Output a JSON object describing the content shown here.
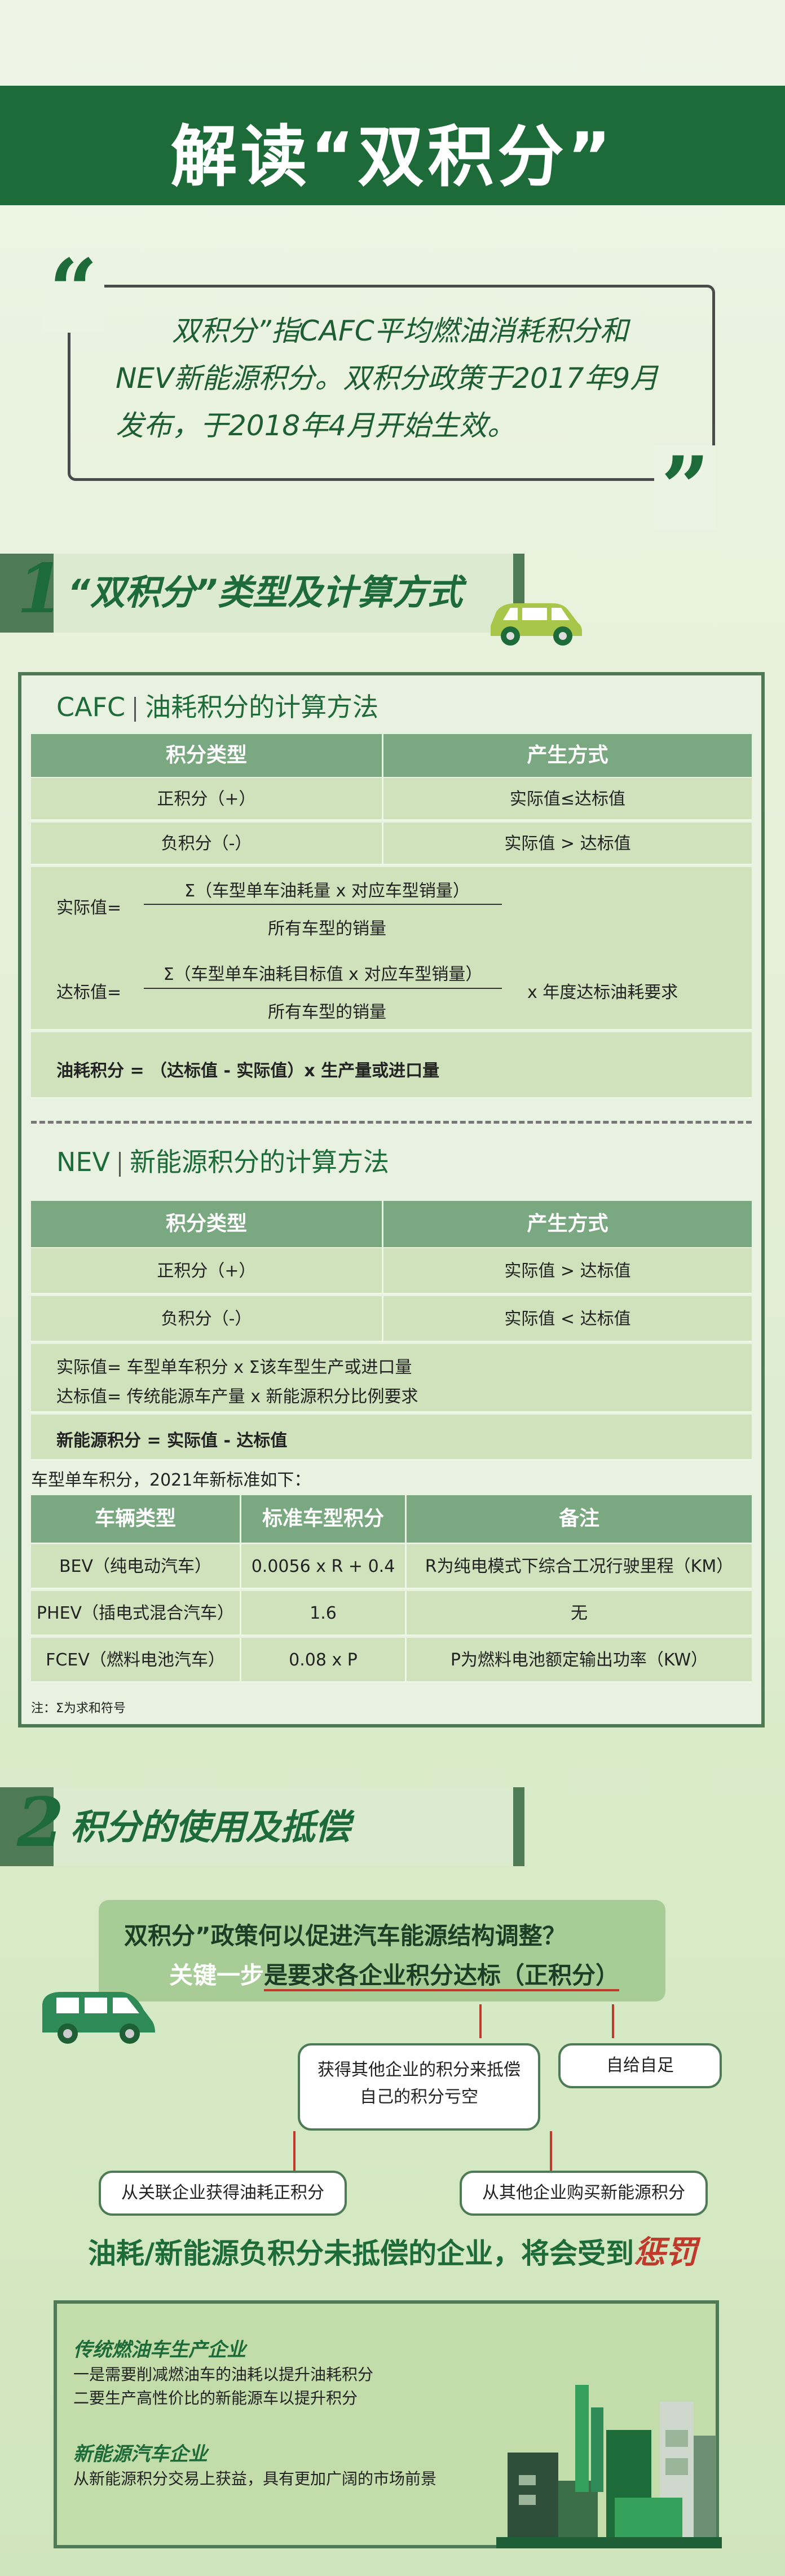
{
  "title": "解读“双积分”",
  "quote": {
    "open_mark": "“",
    "close_mark": "”",
    "text": "双积分”指CAFC平均燃油消耗积分和NEV新能源积分。双积分政策于2017年9月发布，于2018年4月开始生效。"
  },
  "section1": {
    "number": "1",
    "title": "“双积分”类型及计算方式"
  },
  "cafc": {
    "label": "CAFC",
    "heading": "油耗积分的计算方法",
    "col_type": "积分类型",
    "col_method": "产生方式",
    "rows": [
      {
        "type": "正积分（+）",
        "method": "实际值≤达标值"
      },
      {
        "type": "负积分（-）",
        "method": "实际值 > 达标值"
      }
    ],
    "actual_label": "实际值=",
    "actual_num": "Σ（车型单车油耗量 x 对应车型销量）",
    "actual_den": "所有车型的销量",
    "target_label": "达标值=",
    "target_num": "Σ（车型单车油耗目标值 x 对应车型销量）",
    "target_den": "所有车型的销量",
    "target_mult": "x  年度达标油耗要求",
    "result": "油耗积分 = （达标值 - 实际值）x 生产量或进口量"
  },
  "nev": {
    "label": "NEV",
    "heading": "新能源积分的计算方法",
    "col_type": "积分类型",
    "col_method": "产生方式",
    "rows": [
      {
        "type": "正积分（+）",
        "method": "实际值 > 达标值"
      },
      {
        "type": "负积分（-）",
        "method": "实际值 < 达标值"
      }
    ],
    "actual_line": "实际值= 车型单车积分 x Σ该车型生产或进口量",
    "target_line": "达标值= 传统能源车产量 x 新能源积分比例要求",
    "result": "新能源积分 = 实际值 - 达标值",
    "note_2021": "车型单车积分，2021年新标准如下：",
    "std_headers": [
      "车辆类型",
      "标准车型积分",
      "备注"
    ],
    "std_rows": [
      [
        "BEV（纯电动汽车）",
        "0.0056 x R + 0.4",
        "R为纯电模式下综合工况行驶里程（KM）"
      ],
      [
        "PHEV（插电式混合汽车）",
        "1.6",
        "无"
      ],
      [
        "FCEV（燃料电池汽车）",
        "0.08 x P",
        "P为燃料电池额定输出功率（KW）"
      ]
    ],
    "footnote": "注：Σ为求和符号"
  },
  "section2": {
    "number": "2",
    "title": "积分的使用及抵偿"
  },
  "flow": {
    "question": "双积分”政策何以促进汽车能源结构调整？",
    "key_prefix": "关键一步",
    "key_rest": "是要求各企业积分达标（正积分）",
    "box_other": "获得其他企业的积分来抵偿自己的积分亏空",
    "box_self": "自给自足",
    "box_related": "从关联企业获得油耗正积分",
    "box_buy": "从其他企业购买新能源积分",
    "penalty_prefix": "油耗/新能源负积分未抵偿的企业，将会受到",
    "penalty_word": "惩罚"
  },
  "bottom": {
    "trad_title": "传统燃油车生产企业",
    "trad_line1": "一是需要削减燃油车的油耗以提升油耗积分",
    "trad_line2": "二要生产高性价比的新能源车以提升积分",
    "nev_title": "新能源汽车企业",
    "nev_line1": "从新能源积分交易上获益，具有更加广阔的市场前景"
  },
  "colors": {
    "dark_green": "#1e6b3a",
    "mid_green": "#4e7b56",
    "header_green": "#7aa880",
    "row_green": "#cfe2bb",
    "red": "#c0392b"
  }
}
